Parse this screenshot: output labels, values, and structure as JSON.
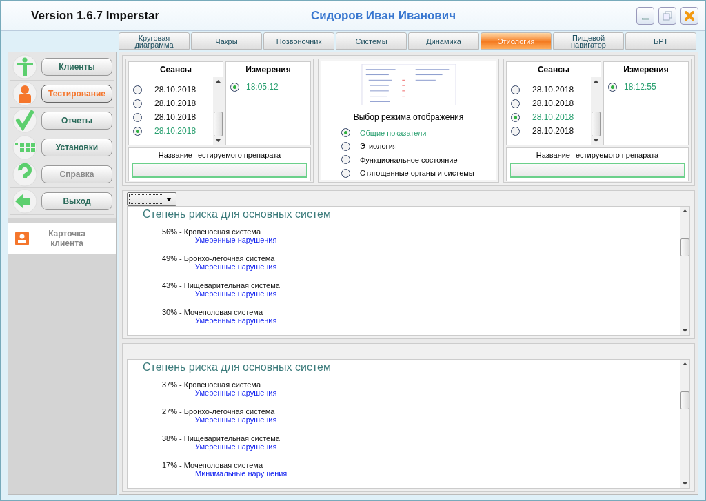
{
  "window": {
    "version": "Version 1.6.7 Imperstar",
    "user": "Сидоров  Иван  Иванович"
  },
  "tabs": [
    {
      "label": "Круговая диаграмма",
      "selected": false
    },
    {
      "label": "Чакры",
      "selected": false
    },
    {
      "label": "Позвоночник",
      "selected": false
    },
    {
      "label": "Системы",
      "selected": false
    },
    {
      "label": "Динамика",
      "selected": false
    },
    {
      "label": "Этиология",
      "selected": true
    },
    {
      "label": "Пищевой навигатор",
      "selected": false
    },
    {
      "label": "БРТ",
      "selected": false
    }
  ],
  "sidebar": {
    "items": [
      {
        "kind": "figure",
        "label": "Клиенты",
        "selected": false,
        "disabled": false
      },
      {
        "kind": "user",
        "label": "Тестирование",
        "selected": true,
        "disabled": false
      },
      {
        "kind": "check",
        "label": "Отчеты",
        "selected": false,
        "disabled": false
      },
      {
        "kind": "grid",
        "label": "Установки",
        "selected": false,
        "disabled": false
      },
      {
        "kind": "question",
        "label": "Справка",
        "selected": false,
        "disabled": true
      },
      {
        "kind": "arrow",
        "label": "Выход",
        "selected": false,
        "disabled": false
      }
    ],
    "card": "Карточка клиента"
  },
  "left_test": {
    "sessions_title": "Сеансы",
    "sessions": [
      {
        "date": "28.10.2018",
        "selected": false
      },
      {
        "date": "28.10.2018",
        "selected": false
      },
      {
        "date": "28.10.2018",
        "selected": false
      },
      {
        "date": "28.10.2018",
        "selected": true
      }
    ],
    "measurements_title": "Измерения",
    "measurements": [
      {
        "time": "18:05:12",
        "selected": true
      }
    ],
    "drug_label": "Название тестируемого препарата"
  },
  "display_mode": {
    "title": "Выбор режима отображения",
    "options": [
      {
        "label": "Общие показатели",
        "selected": true
      },
      {
        "label": "Этиология",
        "selected": false
      },
      {
        "label": "Функциональное состояние",
        "selected": false
      },
      {
        "label": "Отягощенные органы и системы",
        "selected": false
      }
    ]
  },
  "right_test": {
    "sessions_title": "Сеансы",
    "sessions": [
      {
        "date": "28.10.2018",
        "selected": false
      },
      {
        "date": "28.10.2018",
        "selected": false
      },
      {
        "date": "28.10.2018",
        "selected": true
      },
      {
        "date": "28.10.2018",
        "selected": false
      }
    ],
    "measurements_title": "Измерения",
    "measurements": [
      {
        "time": "18:12:55",
        "selected": true
      }
    ],
    "drug_label": "Название тестируемого препарата"
  },
  "reports": [
    {
      "has_dropdown": true,
      "title": "Степень риска для основных систем",
      "items": [
        {
          "system": "56% - Кровеносная система",
          "status": "Умеренные нарушения"
        },
        {
          "system": "49% - Бронхо-легочная система",
          "status": "Умеренные нарушения"
        },
        {
          "system": "43% - Пищеварительная система",
          "status": "Умеренные нарушения"
        },
        {
          "system": "30% - Мочеполовая система",
          "status": "Умеренные нарушения"
        }
      ]
    },
    {
      "has_dropdown": false,
      "title": "Степень риска для основных систем",
      "items": [
        {
          "system": "37% - Кровеносная система",
          "status": "Умеренные нарушения"
        },
        {
          "system": "27% - Бронхо-легочная система",
          "status": "Умеренные нарушения"
        },
        {
          "system": "38% - Пищеварительная система",
          "status": "Умеренные нарушения"
        },
        {
          "system": "17% - Мочеполовая система",
          "status": "Минимальные нарушения"
        }
      ]
    }
  ]
}
